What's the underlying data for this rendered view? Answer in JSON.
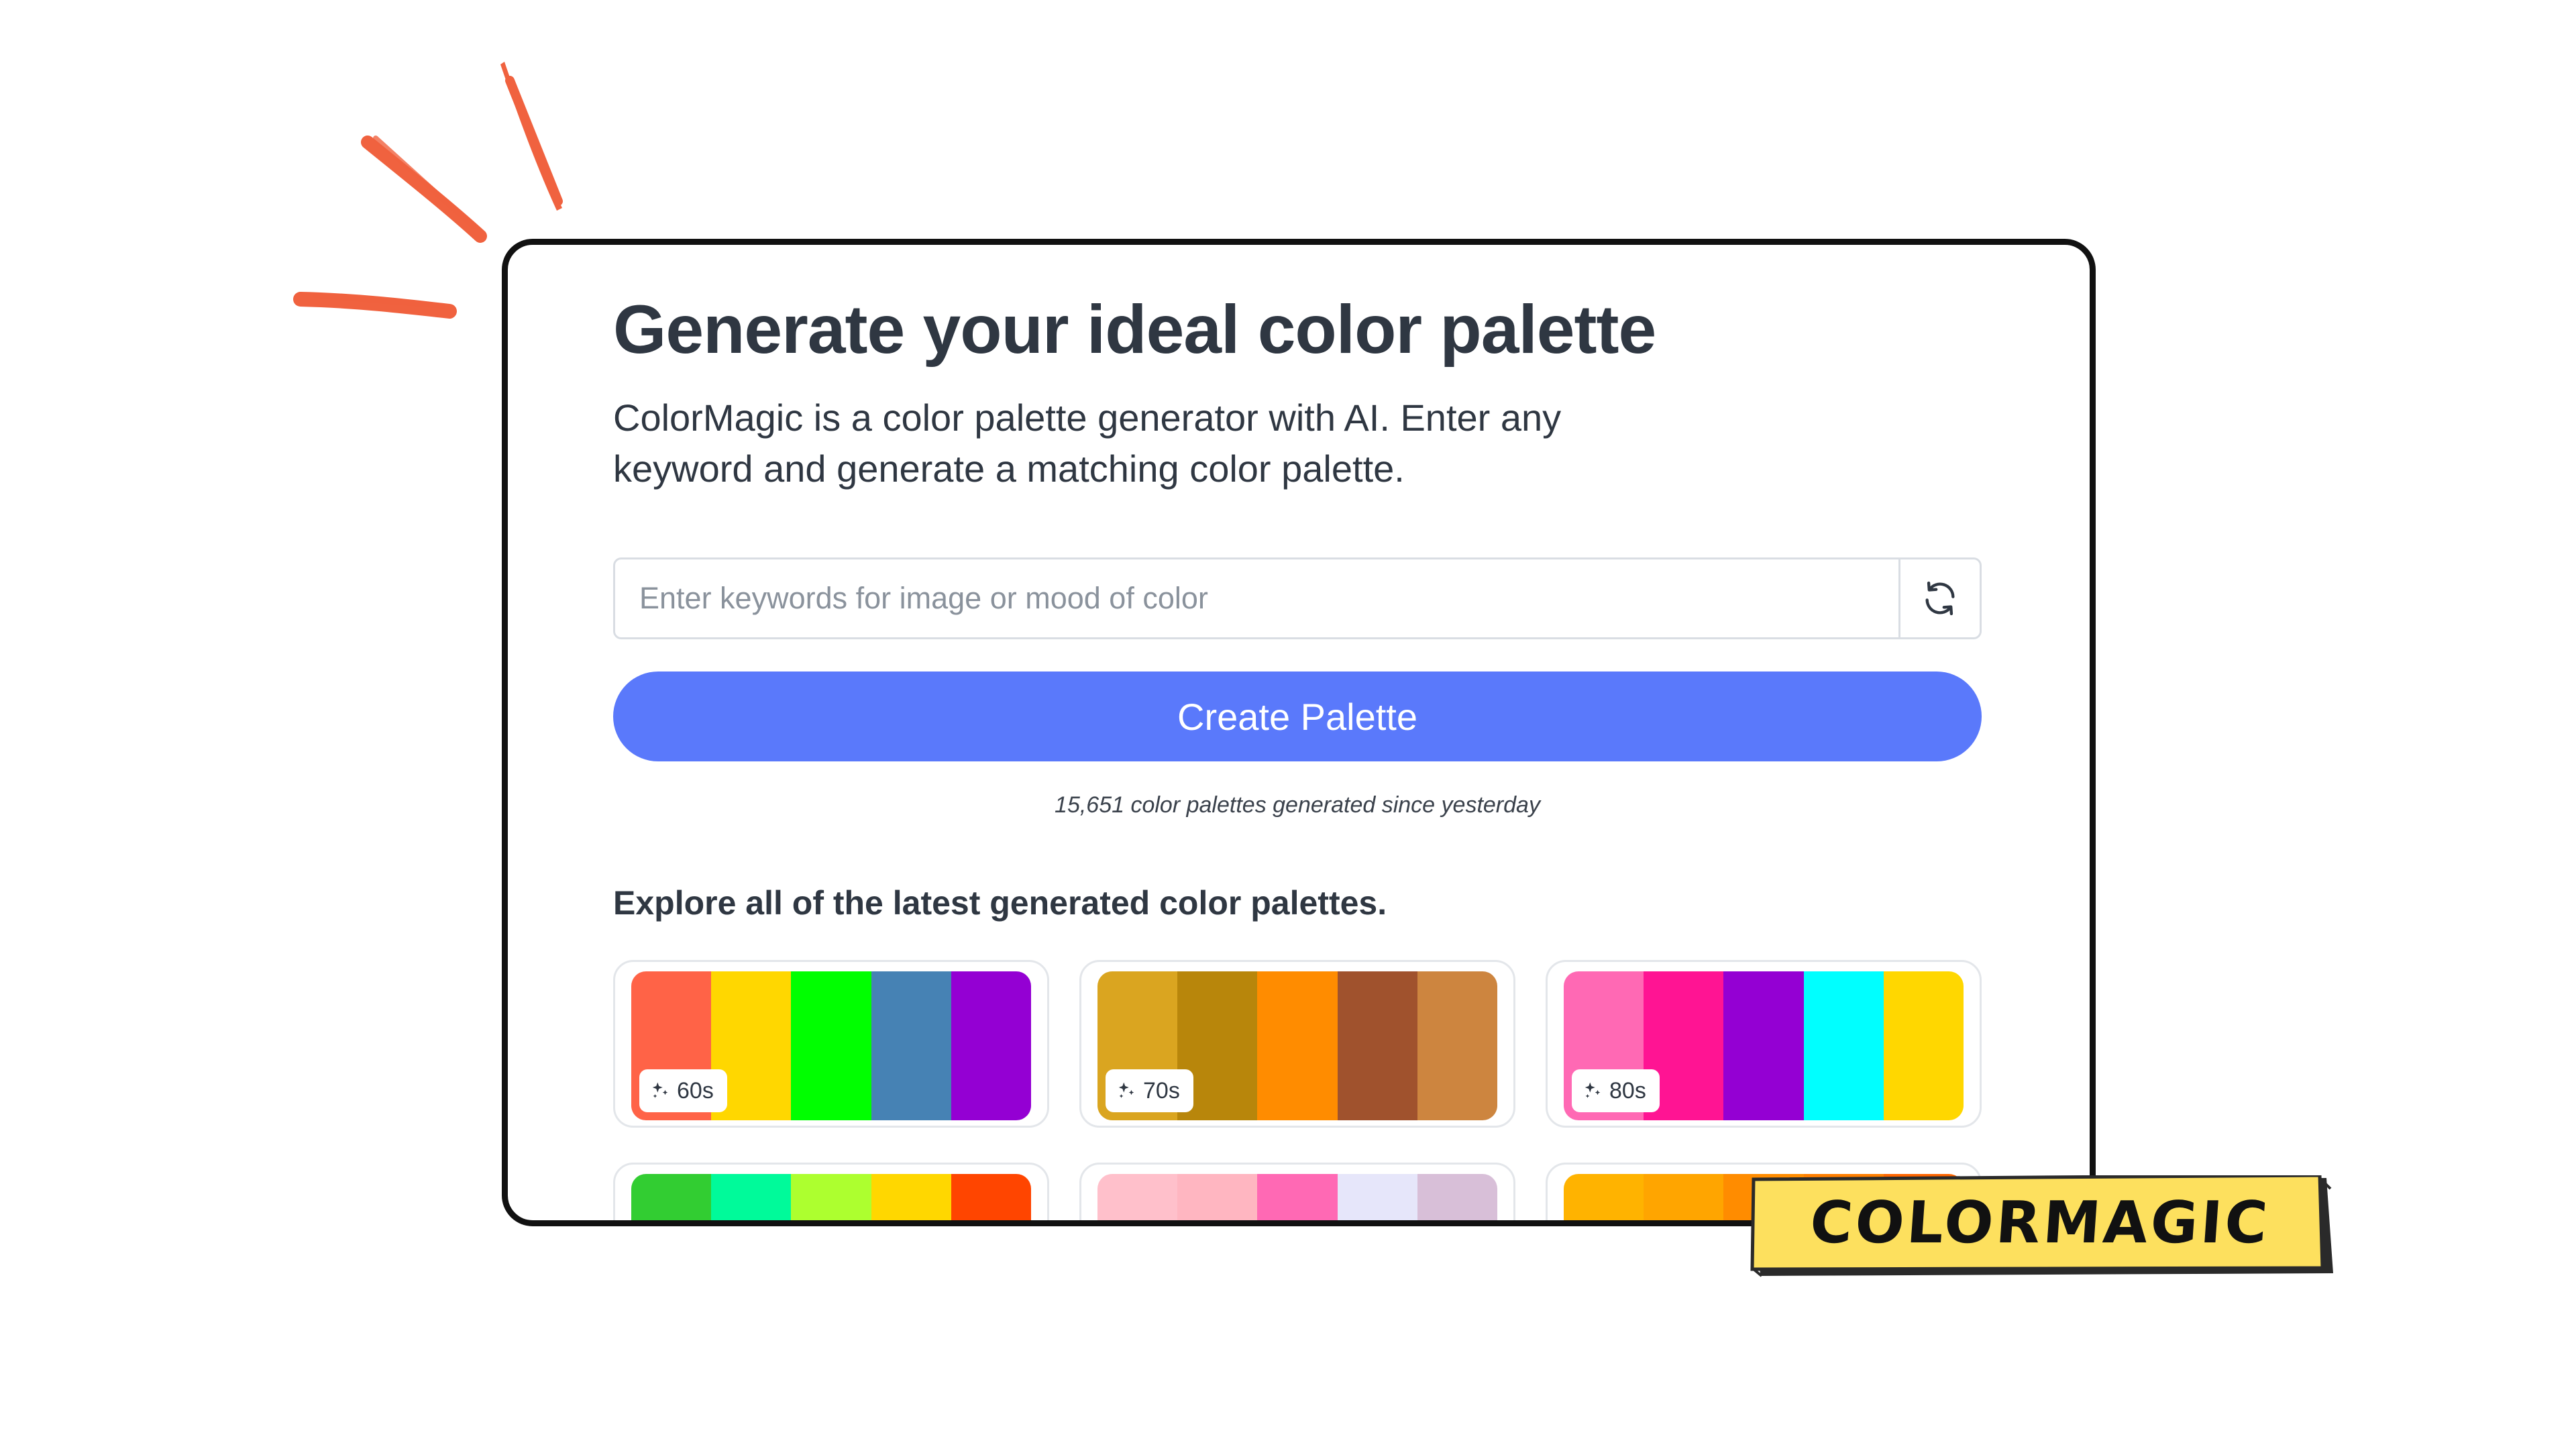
{
  "hero": {
    "title": "Generate your ideal color palette",
    "subtitle": "ColorMagic is a color palette generator with AI. Enter any keyword and generate a matching color palette."
  },
  "search": {
    "placeholder": "Enter keywords for image or mood of color",
    "value": "",
    "refresh_icon": "refresh-icon"
  },
  "create_button": {
    "label": "Create Palette"
  },
  "counter_text": "15,651 color palettes generated since yesterday",
  "explore_heading": "Explore all of the latest generated color palettes.",
  "palettes": [
    {
      "label": "60s",
      "colors": [
        "#FF6347",
        "#FFD700",
        "#00FF00",
        "#4682B4",
        "#9400D3"
      ]
    },
    {
      "label": "70s",
      "colors": [
        "#DAA520",
        "#B8860B",
        "#FF8C00",
        "#A0522D",
        "#CD853F"
      ]
    },
    {
      "label": "80s",
      "colors": [
        "#FF69B4",
        "#FF1493",
        "#9400D3",
        "#00FFFF",
        "#FFD700"
      ]
    },
    {
      "label": "",
      "colors": [
        "#32CD32",
        "#00FA9A",
        "#ADFF2F",
        "#FFD700",
        "#FF4500"
      ]
    },
    {
      "label": "",
      "colors": [
        "#FFC0CB",
        "#FFB6C1",
        "#FF69B4",
        "#E6E6FA",
        "#D8BFD8"
      ]
    },
    {
      "label": "",
      "colors": [
        "#FFB300",
        "#FFA500",
        "#FF8C00",
        "#FF7F00",
        "#FF6600"
      ]
    }
  ],
  "logo": {
    "text": "COLORMAGIC",
    "color": "#FDE05E"
  },
  "colors": {
    "accent": "#5A79FB",
    "burst": "#F0623F",
    "heading": "#2F3742"
  }
}
